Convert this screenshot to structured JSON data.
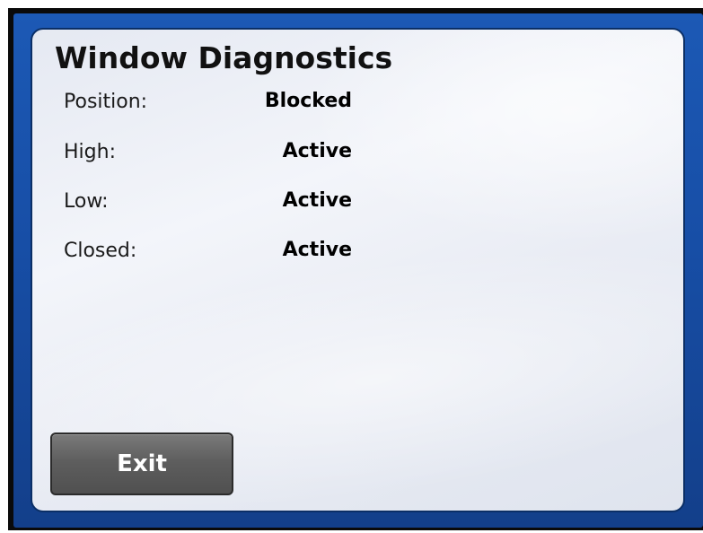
{
  "dialog": {
    "title": "Window Diagnostics",
    "rows": [
      {
        "label": "Position:",
        "value": "Blocked"
      },
      {
        "label": "High:",
        "value": "Active"
      },
      {
        "label": "Low:",
        "value": "Active"
      },
      {
        "label": "Closed:",
        "value": "Active"
      }
    ],
    "exit_label": "Exit"
  },
  "colors": {
    "frame_blue": "#1c59b5",
    "panel_background": "#eef1f7",
    "button_gray": "#5e5e5e",
    "button_text": "#ffffff"
  }
}
